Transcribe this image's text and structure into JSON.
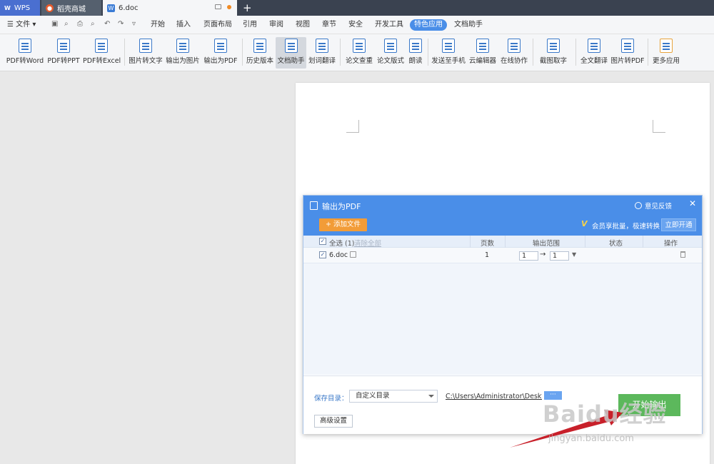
{
  "tabs": [
    {
      "label": "WPS"
    },
    {
      "label": "稻壳商城"
    },
    {
      "label": "6.doc"
    }
  ],
  "menu": {
    "file_label": "文件",
    "items": [
      "开始",
      "插入",
      "页面布局",
      "引用",
      "审阅",
      "视图",
      "章节",
      "安全",
      "开发工具",
      "特色应用",
      "文档助手"
    ],
    "active": "特色应用"
  },
  "ribbon": {
    "buttons": [
      "PDF转Word",
      "PDF转PPT",
      "PDF转Excel",
      "图片转文字",
      "输出为图片",
      "输出为PDF",
      "历史版本",
      "文档助手",
      "划词翻译",
      "论文查重",
      "论文版式",
      "朗读",
      "发送至手机",
      "云编辑器",
      "在线协作",
      "截图取字",
      "全文翻译",
      "图片转PDF",
      "更多应用"
    ],
    "selected": "文档助手"
  },
  "dialog": {
    "title": "输出为PDF",
    "feedback": "意见反馈",
    "add_file": "添加文件",
    "vip_mark": "V",
    "vip_text": "会员享批量，极速转换",
    "vip_button": "立即开通",
    "header": {
      "select_all": "全选 (1)",
      "clear_all": "清除全部",
      "pages": "页数",
      "range": "输出范围",
      "status": "状态",
      "action": "操作"
    },
    "rows": [
      {
        "name": "6.doc",
        "pages": "1",
        "from": "1",
        "to": "1"
      }
    ],
    "save_label": "保存目录：",
    "save_option": "自定义目录",
    "save_path": "C:\\Users\\Administrator\\Desktop",
    "browse": "···",
    "start": "开始输出",
    "advanced": "高级设置"
  },
  "watermark": {
    "main": "Baidu经验",
    "sub": "jingyan.baidu.com"
  },
  "colors": {
    "accent": "#4a8ee8",
    "start": "#5cb85c",
    "add": "#f29c38",
    "arrow": "#c8202a"
  }
}
